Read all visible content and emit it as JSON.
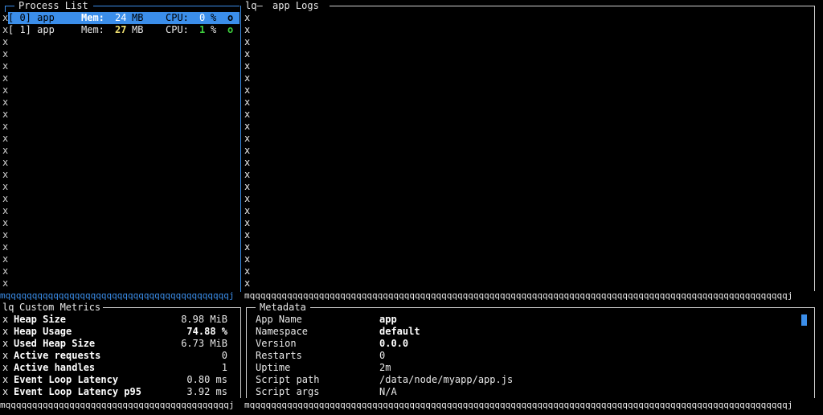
{
  "process_list": {
    "title": "Process List",
    "rows": [
      {
        "id_label": "[ 0] app",
        "mem_label": "Mem:",
        "mem_value": "24",
        "mem_unit": "MB",
        "cpu_label": "CPU:",
        "cpu_value": "0",
        "cpu_unit": "%",
        "status": "o",
        "selected": true
      },
      {
        "id_label": "[ 1] app",
        "mem_label": "Mem:",
        "mem_value": "27",
        "mem_unit": "MB",
        "cpu_label": "CPU:",
        "cpu_value": "1",
        "cpu_unit": "%",
        "status": "o",
        "selected": false
      }
    ]
  },
  "logs": {
    "corner": "lq—",
    "title": "app Logs"
  },
  "metrics": {
    "corner": "lq",
    "title": "Custom Metrics",
    "rows": [
      {
        "label": "Heap Size",
        "value": "8.98 MiB"
      },
      {
        "label": "Heap Usage",
        "value": "74.88 %"
      },
      {
        "label": "Used Heap Size",
        "value": "6.73 MiB"
      },
      {
        "label": "Active requests",
        "value": "0"
      },
      {
        "label": "Active handles",
        "value": "1"
      },
      {
        "label": "Event Loop Latency",
        "value": "0.80 ms"
      },
      {
        "label": "Event Loop Latency p95",
        "value": "3.92 ms"
      }
    ]
  },
  "metadata": {
    "title": "Metadata",
    "rows": [
      {
        "key": "App Name",
        "value": "app",
        "bold": true
      },
      {
        "key": "Namespace",
        "value": "default",
        "bold": true
      },
      {
        "key": "Version",
        "value": "0.0.0",
        "bold": true
      },
      {
        "key": "Restarts",
        "value": "0",
        "bold": false
      },
      {
        "key": "Uptime",
        "value": "2m",
        "bold": false
      },
      {
        "key": "Script path",
        "value": "/data/node/myapp/app.js",
        "bold": false
      },
      {
        "key": "Script args",
        "value": "N/A",
        "bold": false
      }
    ]
  },
  "border_chars": {
    "x": "x",
    "m_prefix": "m",
    "q_fill": "q",
    "j_suffix": "j"
  },
  "colors": {
    "accent": "#3b8eea",
    "background": "#000000",
    "memory_value": "#f0e070",
    "status_online": "#3fd23f"
  }
}
